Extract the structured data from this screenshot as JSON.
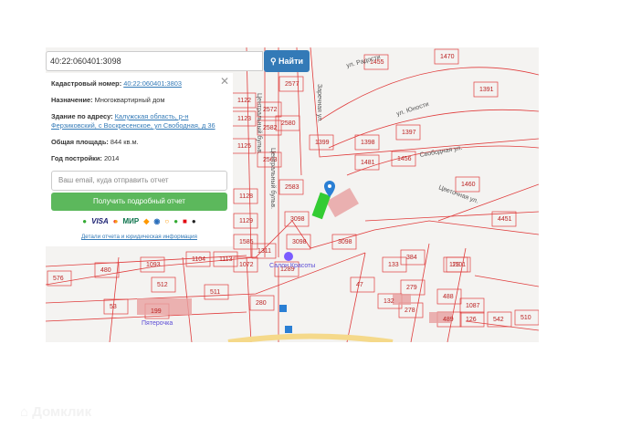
{
  "search": {
    "value": "40:22:060401:3098",
    "button_label": "Найти",
    "icon": "search-icon"
  },
  "info": {
    "cadastral_label": "Кадастровый номер:",
    "cadastral_value": "40:22:060401:3803",
    "purpose_label": "Назначение:",
    "purpose_value": "Многоквартирный дом",
    "address_label": "Здание по адресу:",
    "address_value": "Калужская область, р-н Ферзиковский, с Воскресенское, ул Свободная, д 36",
    "area_label": "Общая площадь:",
    "area_value": "844 кв.м.",
    "year_label": "Год постройки:",
    "year_value": "2014",
    "email_placeholder": "Ваш email, куда отправить отчет",
    "report_button": "Получить подробный отчет",
    "payments": [
      "sberbank-icon",
      "VISA",
      "mastercard-icon",
      "МИР",
      "yandex-money-icon",
      "webmoney-icon",
      "qiwi-icon",
      "alfa-icon",
      "mts-icon",
      "beeline-icon"
    ],
    "details_link": "Детали отчета и юридическая информация"
  },
  "map": {
    "streets": [
      "ул. Радости",
      "ул. Юности",
      "Свободная ул.",
      "Цветочная ул.",
      "Центральный бульв.",
      "Центральный бульв.",
      "Заречная ул."
    ],
    "poi": "Салон Красоты",
    "shop": "Пятерочка",
    "parcels": [
      "1455",
      "1470",
      "1391",
      "1397",
      "1398",
      "1399",
      "1481",
      "1456",
      "1460",
      "4451",
      "2583",
      "3098",
      "3098",
      "3098",
      "2577",
      "2572",
      "2582",
      "2580",
      "2563",
      "1129",
      "1128",
      "1585",
      "1072",
      "1311",
      "1289",
      "280",
      "47",
      "133",
      "384",
      "279",
      "132",
      "278",
      "129",
      "488",
      "489",
      "576",
      "480",
      "1093",
      "1104",
      "1113",
      "512",
      "511",
      "53",
      "199",
      "1101",
      "1087",
      "126",
      "542",
      "510",
      "1122",
      "1123",
      "1125"
    ],
    "colors": {
      "parcel": "#e03c3c",
      "building": "#e8a0a0",
      "selected": "#33cc33",
      "marker": "#2a7fd4"
    }
  },
  "watermark": "Домклик"
}
